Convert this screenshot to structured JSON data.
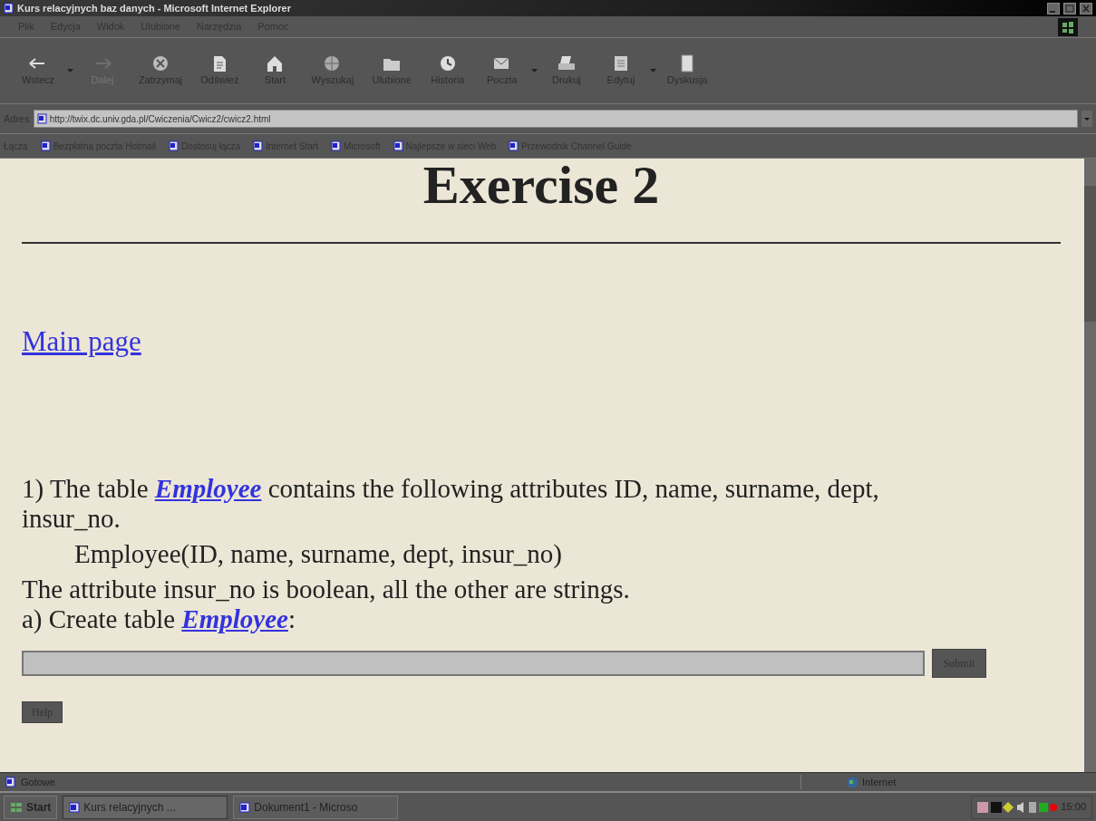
{
  "window": {
    "title": "Kurs relacyjnych baz danych - Microsoft Internet Explorer"
  },
  "menu": [
    "Plik",
    "Edycja",
    "Widok",
    "Ulubione",
    "Narzędzia",
    "Pomoc"
  ],
  "toolbar": [
    {
      "label": "Wstecz",
      "kind": "back",
      "disabled": false,
      "dropdown": true
    },
    {
      "label": "Dalej",
      "kind": "forward",
      "disabled": true,
      "dropdown": false
    },
    {
      "label": "Zatrzymaj",
      "kind": "stop",
      "disabled": false,
      "dropdown": false
    },
    {
      "label": "Odśwież",
      "kind": "refresh",
      "disabled": false,
      "dropdown": false
    },
    {
      "label": "Start",
      "kind": "home",
      "disabled": false,
      "dropdown": false
    },
    {
      "label": "Wyszukaj",
      "kind": "search",
      "disabled": false,
      "dropdown": false
    },
    {
      "label": "Ulubione",
      "kind": "folder",
      "disabled": false,
      "dropdown": false
    },
    {
      "label": "Historia",
      "kind": "history",
      "disabled": false,
      "dropdown": false
    },
    {
      "label": "Poczta",
      "kind": "mail",
      "disabled": false,
      "dropdown": true
    },
    {
      "label": "Drukuj",
      "kind": "print",
      "disabled": false,
      "dropdown": false
    },
    {
      "label": "Edytuj",
      "kind": "edit",
      "disabled": false,
      "dropdown": true
    },
    {
      "label": "Dyskusja",
      "kind": "discuss",
      "disabled": false,
      "dropdown": false
    }
  ],
  "address": {
    "label": "Adres",
    "value": "http://twix.dc.univ.gda.pl/Cwiczenia/Cwicz2/cwicz2.html"
  },
  "links": {
    "label": "Łącza",
    "items": [
      "Bezpłatna poczta Hotmail",
      "Dostosuj łącza",
      "Internet Start",
      "Microsoft",
      "Najlepsze w sieci Web",
      "Przewodnik Channel Guide"
    ]
  },
  "page": {
    "heading": "Exercise 2",
    "main_link": "Main page",
    "paragraphs": [
      {
        "kind": "text",
        "parts": [
          {
            "text": "1) The table "
          },
          {
            "link": "Employee"
          },
          {
            "text": " contains the following attributes ID, name, surname, dept, insur_no."
          }
        ]
      },
      {
        "kind": "indent",
        "parts": [
          {
            "text": "Employee(ID, name, surname, dept, insur_no)"
          }
        ]
      },
      {
        "kind": "text",
        "parts": [
          {
            "text": "The attribute insur_no is boolean, all the other are strings."
          }
        ]
      },
      {
        "kind": "tight",
        "parts": [
          {
            "text": "a) Create table "
          },
          {
            "link": "Employee"
          },
          {
            "text": ":"
          }
        ]
      }
    ],
    "submit": "Submit",
    "help": "Help"
  },
  "status_bar": {
    "text": "Gotowe",
    "zone": "Internet"
  },
  "taskbar": {
    "start": "Start",
    "tasks": [
      {
        "label": "Kurs relacyjnych ...",
        "selected": true
      },
      {
        "label": "Dokument1 - Microso",
        "selected": false
      }
    ],
    "clock": "15:00"
  }
}
